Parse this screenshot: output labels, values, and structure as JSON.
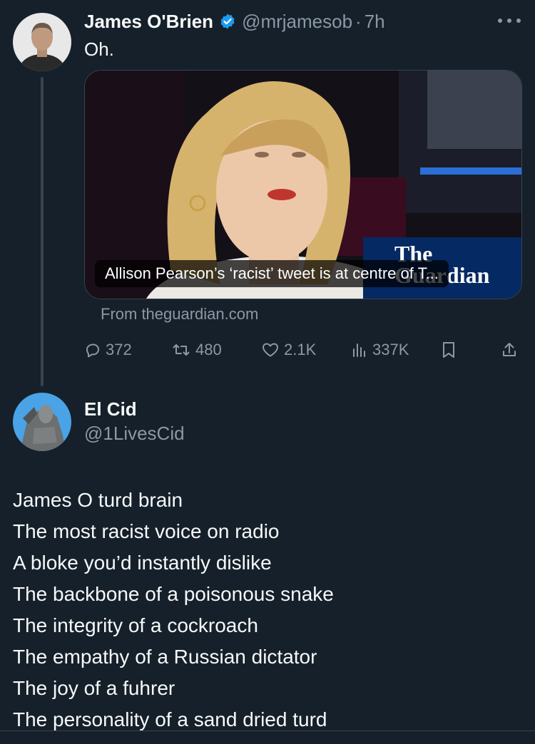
{
  "tweet": {
    "author_name": "James O'Brien",
    "handle": "@mrjamesob",
    "separator": "·",
    "time": "7h",
    "text": "Oh.",
    "card": {
      "logo_line1": "The",
      "logo_line2": "Guardian",
      "caption": "Allison Pearson’s ‘racist’ tweet is at centre of T...",
      "source": "From theguardian.com"
    },
    "stats": {
      "replies": "372",
      "retweets": "480",
      "likes": "2.1K",
      "views": "337K"
    }
  },
  "reply": {
    "author_name": "El Cid",
    "handle": "@1LivesCid",
    "lines": [
      "James O turd brain",
      "The most racist voice on radio",
      "A bloke you’d instantly dislike",
      "The backbone of a poisonous snake",
      "The integrity of a cockroach",
      "The empathy of a Russian dictator",
      "The joy of a fuhrer",
      "The personality of a sand dried turd"
    ]
  },
  "icons": {
    "verified": "verified-badge-icon",
    "more": "more-icon",
    "reply": "reply-icon",
    "retweet": "retweet-icon",
    "like": "heart-icon",
    "views": "views-icon",
    "bookmark": "bookmark-icon",
    "share": "share-icon"
  },
  "colors": {
    "background": "#15202b",
    "text": "#f7f9f9",
    "secondary": "#8b98a5",
    "verified": "#1d9bf0",
    "guardian": "#052962"
  }
}
